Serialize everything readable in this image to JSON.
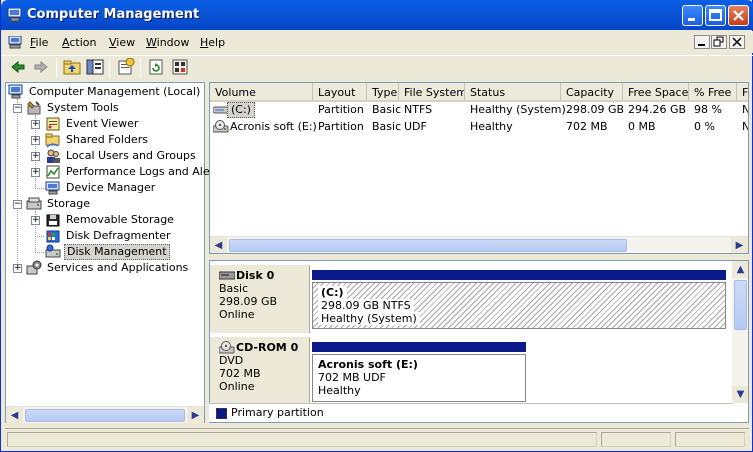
{
  "window": {
    "title": "Computer Management",
    "colors": {
      "titlebar": "#0a5ee8",
      "selection": "#d6d3ce",
      "primary_partition": "#0a1a8a"
    }
  },
  "menubar": {
    "items": [
      {
        "label": "File",
        "mnemonic": "F"
      },
      {
        "label": "Action",
        "mnemonic": "A"
      },
      {
        "label": "View",
        "mnemonic": "V"
      },
      {
        "label": "Window",
        "mnemonic": "W"
      },
      {
        "label": "Help",
        "mnemonic": "H"
      }
    ]
  },
  "toolbar": {
    "icons": [
      "back-arrow-icon",
      "forward-arrow-icon",
      "up-folder-icon",
      "show-hide-tree-icon",
      "properties-icon",
      "refresh-icon",
      "help-icon"
    ]
  },
  "tree": {
    "root": "Computer Management (Local)",
    "system_tools": "System Tools",
    "event_viewer": "Event Viewer",
    "shared_folders": "Shared Folders",
    "local_users": "Local Users and Groups",
    "perf_logs": "Performance Logs and Alerts",
    "device_manager": "Device Manager",
    "storage": "Storage",
    "removable_storage": "Removable Storage",
    "disk_defrag": "Disk Defragmenter",
    "disk_management": "Disk Management",
    "services_apps": "Services and Applications"
  },
  "volumes": {
    "columns": [
      "Volume",
      "Layout",
      "Type",
      "File System",
      "Status",
      "Capacity",
      "Free Space",
      "% Free",
      "F"
    ],
    "rows": [
      {
        "volume": "(C:)",
        "layout": "Partition",
        "type": "Basic",
        "fs": "NTFS",
        "status": "Healthy (System)",
        "capacity": "298.09 GB",
        "free": "294.26 GB",
        "pct": "98 %",
        "extra": "N"
      },
      {
        "volume": "Acronis soft (E:)",
        "layout": "Partition",
        "type": "Basic",
        "fs": "UDF",
        "status": "Healthy",
        "capacity": "702 MB",
        "free": "0 MB",
        "pct": "0 %",
        "extra": "N"
      }
    ]
  },
  "disks": [
    {
      "name": "Disk 0",
      "kind": "Basic",
      "size": "298.09 GB",
      "state": "Online",
      "partition": {
        "title": "(C:)",
        "detail": "298.09 GB NTFS",
        "status": "Healthy (System)"
      }
    },
    {
      "name": "CD-ROM 0",
      "kind": "DVD",
      "size": "702 MB",
      "state": "Online",
      "partition": {
        "title": "Acronis soft  (E:)",
        "detail": "702 MB UDF",
        "status": "Healthy"
      }
    }
  ],
  "legend": {
    "primary": "Primary partition"
  }
}
